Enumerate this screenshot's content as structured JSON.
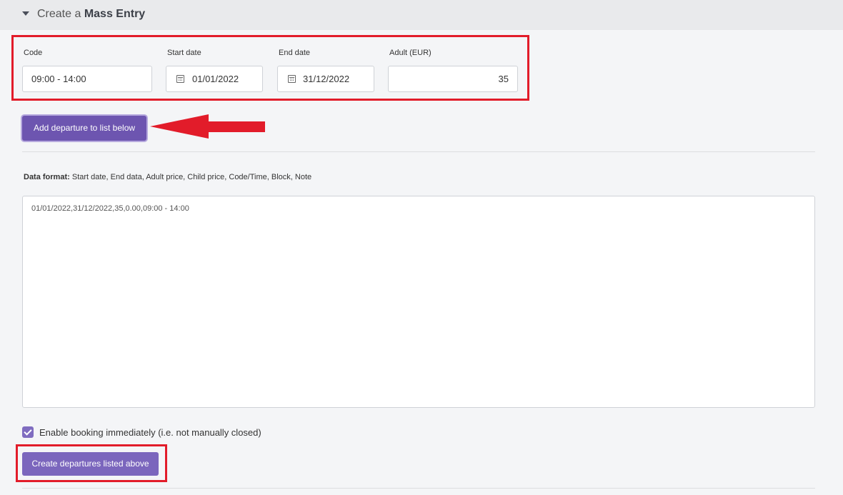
{
  "header": {
    "title_prefix": "Create a",
    "title_bold": "Mass Entry"
  },
  "fields": {
    "code": {
      "label": "Code",
      "value": "09:00 - 14:00"
    },
    "start_date": {
      "label": "Start date",
      "value": "01/01/2022"
    },
    "end_date": {
      "label": "End date",
      "value": "31/12/2022"
    },
    "adult": {
      "label": "Adult (EUR)",
      "value": "35"
    }
  },
  "buttons": {
    "add_departure": "Add departure to list below",
    "create_departures": "Create departures listed above"
  },
  "data_format": {
    "label": "Data format:",
    "text": "Start date, End data, Adult price, Child price, Code/Time, Block, Note"
  },
  "textarea": {
    "value": "01/01/2022,31/12/2022,35,0.00,09:00 - 14:00"
  },
  "checkbox": {
    "checked": true,
    "label": "Enable booking immediately (i.e. not manually closed)"
  },
  "colors": {
    "accent": "#6d55b0",
    "annotation": "#e21c2a"
  },
  "icons": [
    "caret-down-icon",
    "calendar-icon",
    "check-icon"
  ]
}
